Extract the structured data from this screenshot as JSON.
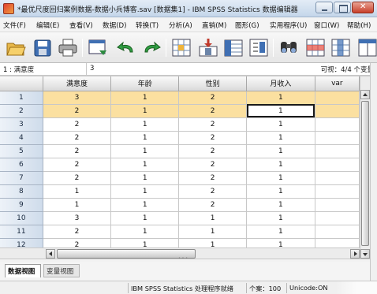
{
  "window": {
    "title": "*最优尺度回归案例数据-数据小兵博客.sav [数据集1] - IBM SPSS Statistics 数据编辑器"
  },
  "menu": [
    {
      "label": "文件(F)",
      "underline": "F"
    },
    {
      "label": "编辑(E)",
      "underline": "E"
    },
    {
      "label": "查看(V)",
      "underline": "V"
    },
    {
      "label": "数据(D)",
      "underline": "D"
    },
    {
      "label": "转换(T)",
      "underline": "T"
    },
    {
      "label": "分析(A)",
      "underline": "A"
    },
    {
      "label": "直销(M)",
      "underline": "M"
    },
    {
      "label": "图形(G)",
      "underline": "G"
    },
    {
      "label": "实用程序(U)",
      "underline": "U"
    },
    {
      "label": "窗口(W)",
      "underline": "W"
    },
    {
      "label": "帮助(H)",
      "underline": "H"
    }
  ],
  "toolbar": {
    "icons": [
      "open-icon",
      "save-icon",
      "print-icon",
      "dialog-recall-icon",
      "undo-icon",
      "redo-icon",
      "go-to-case-icon",
      "go-to-variable-icon",
      "variables-icon",
      "run-descriptives-icon",
      "find-icon",
      "insert-cases-icon",
      "insert-variable-icon"
    ]
  },
  "cell_editor": {
    "reference": "1 : 满意度",
    "value": "3",
    "visible": "可视：4/4 个变量"
  },
  "grid": {
    "columns": [
      "满意度",
      "年龄",
      "性别",
      "月收入",
      "var"
    ],
    "rows": [
      {
        "n": "1",
        "cells": [
          "3",
          "1",
          "2",
          "1"
        ]
      },
      {
        "n": "2",
        "cells": [
          "2",
          "1",
          "2",
          "1"
        ]
      },
      {
        "n": "3",
        "cells": [
          "2",
          "1",
          "2",
          "1"
        ]
      },
      {
        "n": "4",
        "cells": [
          "2",
          "1",
          "2",
          "1"
        ]
      },
      {
        "n": "5",
        "cells": [
          "2",
          "1",
          "2",
          "1"
        ]
      },
      {
        "n": "6",
        "cells": [
          "2",
          "1",
          "2",
          "1"
        ]
      },
      {
        "n": "7",
        "cells": [
          "2",
          "1",
          "2",
          "1"
        ]
      },
      {
        "n": "8",
        "cells": [
          "1",
          "1",
          "2",
          "1"
        ]
      },
      {
        "n": "9",
        "cells": [
          "1",
          "1",
          "2",
          "1"
        ]
      },
      {
        "n": "10",
        "cells": [
          "3",
          "1",
          "1",
          "1"
        ]
      },
      {
        "n": "11",
        "cells": [
          "2",
          "1",
          "1",
          "1"
        ]
      },
      {
        "n": "12",
        "cells": [
          "2",
          "1",
          "1",
          "1"
        ]
      }
    ],
    "selected_rows": [
      1,
      2
    ],
    "active_cell": {
      "row": 2,
      "column": 4
    }
  },
  "tabs": {
    "data_view": "数据视图",
    "variable_view": "变量视图"
  },
  "status": {
    "processor": "IBM SPSS Statistics 处理程序就绪",
    "cases": "个案：100",
    "unicode": "Unicode:ON"
  },
  "colors": {
    "selected_row": "#fbe0a0",
    "row_header": "#cfdceb",
    "title_bar": "#c4d6ea"
  }
}
